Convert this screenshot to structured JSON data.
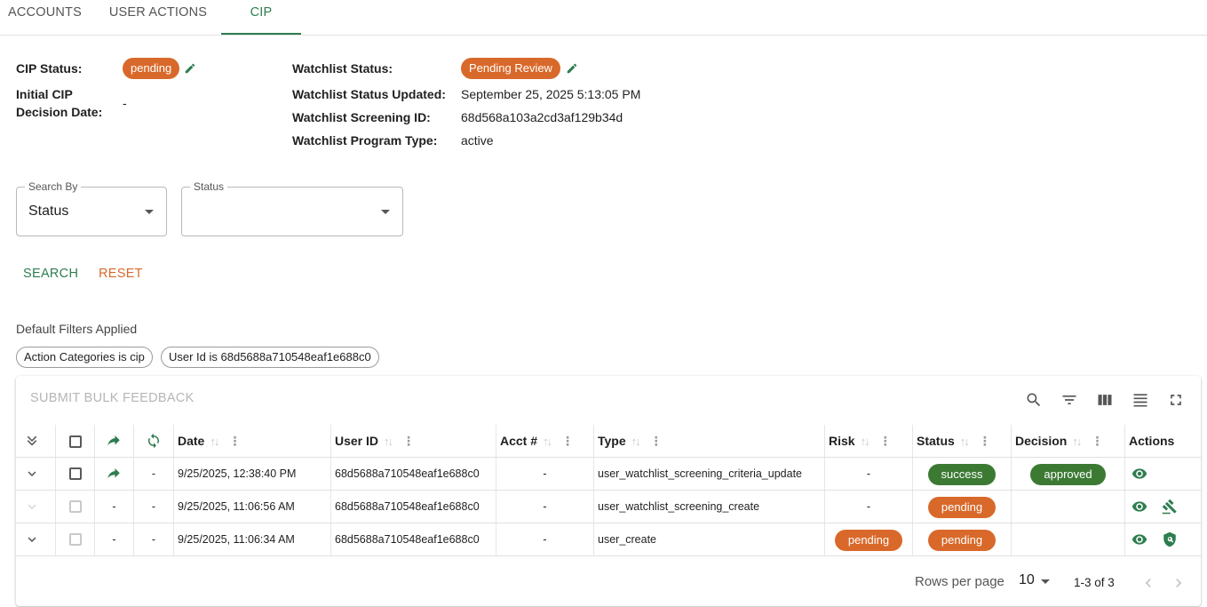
{
  "tabs": [
    {
      "label": "ACCOUNTS",
      "active": false
    },
    {
      "label": "USER ACTIONS",
      "active": false
    },
    {
      "label": "CIP",
      "active": true
    }
  ],
  "cip": {
    "status_label": "CIP Status:",
    "status_value": "pending",
    "decision_label_1": "Initial CIP",
    "decision_label_2": "Decision Date:",
    "decision_value": "-",
    "watchlist_status_label": "Watchlist Status:",
    "watchlist_status_value": "Pending Review",
    "watchlist_updated_label": "Watchlist Status Updated:",
    "watchlist_updated_value": "September 25, 2025 5:13:05 PM",
    "screening_id_label": "Watchlist Screening ID:",
    "screening_id_value": "68d568a103a2cd3af129b34d",
    "program_type_label": "Watchlist Program Type:",
    "program_type_value": "active"
  },
  "search": {
    "search_by_label": "Search By",
    "search_by_value": "Status",
    "status_label": "Status",
    "status_value": "",
    "search_button": "SEARCH",
    "reset_button": "RESET"
  },
  "filters": {
    "heading": "Default Filters Applied",
    "chips": [
      "Action Categories is cip",
      "User Id is 68d5688a710548eaf1e688c0"
    ]
  },
  "table": {
    "bulk_button": "SUBMIT BULK FEEDBACK",
    "columns": {
      "date": "Date",
      "user_id": "User ID",
      "acct": "Acct #",
      "type": "Type",
      "risk": "Risk",
      "status": "Status",
      "decision": "Decision",
      "actions": "Actions"
    },
    "rows": [
      {
        "fwd": "",
        "sync": "-",
        "date": "9/25/2025, 12:38:40 PM",
        "user_id": "68d5688a710548eaf1e688c0",
        "acct": "-",
        "type": "user_watchlist_screening_criteria_update",
        "risk": "-",
        "status": "success",
        "decision": "approved"
      },
      {
        "fwd": "-",
        "sync": "-",
        "date": "9/25/2025, 11:06:56 AM",
        "user_id": "68d5688a710548eaf1e688c0",
        "acct": "-",
        "type": "user_watchlist_screening_create",
        "risk": "-",
        "status": "pending",
        "decision": ""
      },
      {
        "fwd": "-",
        "sync": "-",
        "date": "9/25/2025, 11:06:34 AM",
        "user_id": "68d5688a710548eaf1e688c0",
        "acct": "-",
        "type": "user_create",
        "risk": "pending",
        "status": "pending",
        "decision": ""
      }
    ],
    "rows_per_page_label": "Rows per page",
    "rows_per_page_value": "10",
    "pagination": "1-3 of 3"
  },
  "colors": {
    "accent": "#2e7d4f",
    "orange": "#d9692a",
    "green": "#3c7a34"
  },
  "icons": [
    "pencil-icon",
    "search-icon",
    "filter-icon",
    "columns-icon",
    "density-icon",
    "fullscreen-icon",
    "expand-all-icon",
    "forward-icon",
    "sync-icon",
    "chevron-down-icon",
    "eye-icon",
    "gavel-icon",
    "shield-search-icon",
    "chevron-left-icon",
    "chevron-right-icon",
    "caret-down-icon"
  ]
}
